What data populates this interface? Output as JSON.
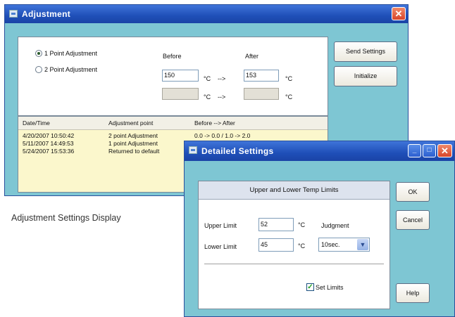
{
  "adjustment_window": {
    "title": "Adjustment",
    "close": "✕",
    "mode_options": [
      "1 Point Adjustment",
      "2 Point Adjustment"
    ],
    "selected_mode": "1 Point Adjustment",
    "before_label": "Before",
    "after_label": "After",
    "row1": {
      "before": "150",
      "after": "153",
      "unit": "°C",
      "arrow": "-->"
    },
    "row2": {
      "before": "",
      "after": "",
      "unit": "°C",
      "arrow": "-->"
    },
    "send_settings": "Send Settings",
    "initialize": "Initialize",
    "table": {
      "columns": [
        "Date/Time",
        "Adjustment point",
        "Before --> After"
      ],
      "rows": [
        [
          "4/20/2007 10:50:42",
          "2 point Adjustment",
          "0.0 -> 0.0 / 1.0 -> 2.0"
        ],
        [
          "5/11/2007 14:49:53",
          "1 point Adjustment",
          ""
        ],
        [
          "5/24/2007 15:53:36",
          "Returned to default",
          ""
        ]
      ]
    }
  },
  "caption": "Adjustment Settings Display",
  "detailed_window": {
    "title": "Detailed Settings",
    "section_title": "Upper and Lower Temp Limits",
    "upper_label": "Upper Limit",
    "upper_value": "52",
    "lower_label": "Lower Limit",
    "lower_value": "45",
    "unit": "°C",
    "judgment_label": "Judgment",
    "judgment_value": "10sec.",
    "set_limits_label": "Set Limits",
    "set_limits_checked": true,
    "ok": "OK",
    "cancel": "Cancel",
    "help": "Help",
    "min": "_",
    "max": "□",
    "close": "✕"
  }
}
